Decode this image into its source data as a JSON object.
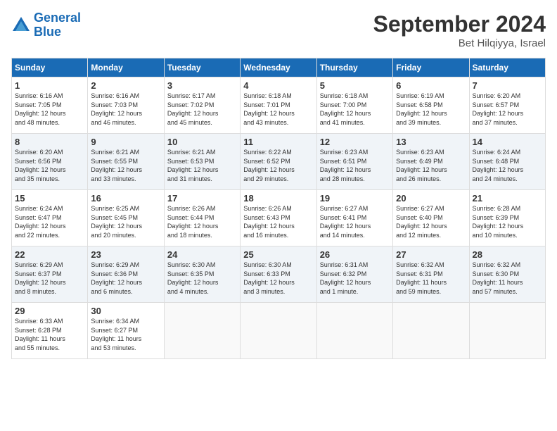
{
  "header": {
    "logo_line1": "General",
    "logo_line2": "Blue",
    "month_title": "September 2024",
    "location": "Bet Hilqiyya, Israel"
  },
  "days_of_week": [
    "Sunday",
    "Monday",
    "Tuesday",
    "Wednesday",
    "Thursday",
    "Friday",
    "Saturday"
  ],
  "weeks": [
    [
      {
        "day": 1,
        "info": "Sunrise: 6:16 AM\nSunset: 7:05 PM\nDaylight: 12 hours\nand 48 minutes."
      },
      {
        "day": 2,
        "info": "Sunrise: 6:16 AM\nSunset: 7:03 PM\nDaylight: 12 hours\nand 46 minutes."
      },
      {
        "day": 3,
        "info": "Sunrise: 6:17 AM\nSunset: 7:02 PM\nDaylight: 12 hours\nand 45 minutes."
      },
      {
        "day": 4,
        "info": "Sunrise: 6:18 AM\nSunset: 7:01 PM\nDaylight: 12 hours\nand 43 minutes."
      },
      {
        "day": 5,
        "info": "Sunrise: 6:18 AM\nSunset: 7:00 PM\nDaylight: 12 hours\nand 41 minutes."
      },
      {
        "day": 6,
        "info": "Sunrise: 6:19 AM\nSunset: 6:58 PM\nDaylight: 12 hours\nand 39 minutes."
      },
      {
        "day": 7,
        "info": "Sunrise: 6:20 AM\nSunset: 6:57 PM\nDaylight: 12 hours\nand 37 minutes."
      }
    ],
    [
      {
        "day": 8,
        "info": "Sunrise: 6:20 AM\nSunset: 6:56 PM\nDaylight: 12 hours\nand 35 minutes."
      },
      {
        "day": 9,
        "info": "Sunrise: 6:21 AM\nSunset: 6:55 PM\nDaylight: 12 hours\nand 33 minutes."
      },
      {
        "day": 10,
        "info": "Sunrise: 6:21 AM\nSunset: 6:53 PM\nDaylight: 12 hours\nand 31 minutes."
      },
      {
        "day": 11,
        "info": "Sunrise: 6:22 AM\nSunset: 6:52 PM\nDaylight: 12 hours\nand 29 minutes."
      },
      {
        "day": 12,
        "info": "Sunrise: 6:23 AM\nSunset: 6:51 PM\nDaylight: 12 hours\nand 28 minutes."
      },
      {
        "day": 13,
        "info": "Sunrise: 6:23 AM\nSunset: 6:49 PM\nDaylight: 12 hours\nand 26 minutes."
      },
      {
        "day": 14,
        "info": "Sunrise: 6:24 AM\nSunset: 6:48 PM\nDaylight: 12 hours\nand 24 minutes."
      }
    ],
    [
      {
        "day": 15,
        "info": "Sunrise: 6:24 AM\nSunset: 6:47 PM\nDaylight: 12 hours\nand 22 minutes."
      },
      {
        "day": 16,
        "info": "Sunrise: 6:25 AM\nSunset: 6:45 PM\nDaylight: 12 hours\nand 20 minutes."
      },
      {
        "day": 17,
        "info": "Sunrise: 6:26 AM\nSunset: 6:44 PM\nDaylight: 12 hours\nand 18 minutes."
      },
      {
        "day": 18,
        "info": "Sunrise: 6:26 AM\nSunset: 6:43 PM\nDaylight: 12 hours\nand 16 minutes."
      },
      {
        "day": 19,
        "info": "Sunrise: 6:27 AM\nSunset: 6:41 PM\nDaylight: 12 hours\nand 14 minutes."
      },
      {
        "day": 20,
        "info": "Sunrise: 6:27 AM\nSunset: 6:40 PM\nDaylight: 12 hours\nand 12 minutes."
      },
      {
        "day": 21,
        "info": "Sunrise: 6:28 AM\nSunset: 6:39 PM\nDaylight: 12 hours\nand 10 minutes."
      }
    ],
    [
      {
        "day": 22,
        "info": "Sunrise: 6:29 AM\nSunset: 6:37 PM\nDaylight: 12 hours\nand 8 minutes."
      },
      {
        "day": 23,
        "info": "Sunrise: 6:29 AM\nSunset: 6:36 PM\nDaylight: 12 hours\nand 6 minutes."
      },
      {
        "day": 24,
        "info": "Sunrise: 6:30 AM\nSunset: 6:35 PM\nDaylight: 12 hours\nand 4 minutes."
      },
      {
        "day": 25,
        "info": "Sunrise: 6:30 AM\nSunset: 6:33 PM\nDaylight: 12 hours\nand 3 minutes."
      },
      {
        "day": 26,
        "info": "Sunrise: 6:31 AM\nSunset: 6:32 PM\nDaylight: 12 hours\nand 1 minute."
      },
      {
        "day": 27,
        "info": "Sunrise: 6:32 AM\nSunset: 6:31 PM\nDaylight: 11 hours\nand 59 minutes."
      },
      {
        "day": 28,
        "info": "Sunrise: 6:32 AM\nSunset: 6:30 PM\nDaylight: 11 hours\nand 57 minutes."
      }
    ],
    [
      {
        "day": 29,
        "info": "Sunrise: 6:33 AM\nSunset: 6:28 PM\nDaylight: 11 hours\nand 55 minutes."
      },
      {
        "day": 30,
        "info": "Sunrise: 6:34 AM\nSunset: 6:27 PM\nDaylight: 11 hours\nand 53 minutes."
      },
      null,
      null,
      null,
      null,
      null
    ]
  ]
}
